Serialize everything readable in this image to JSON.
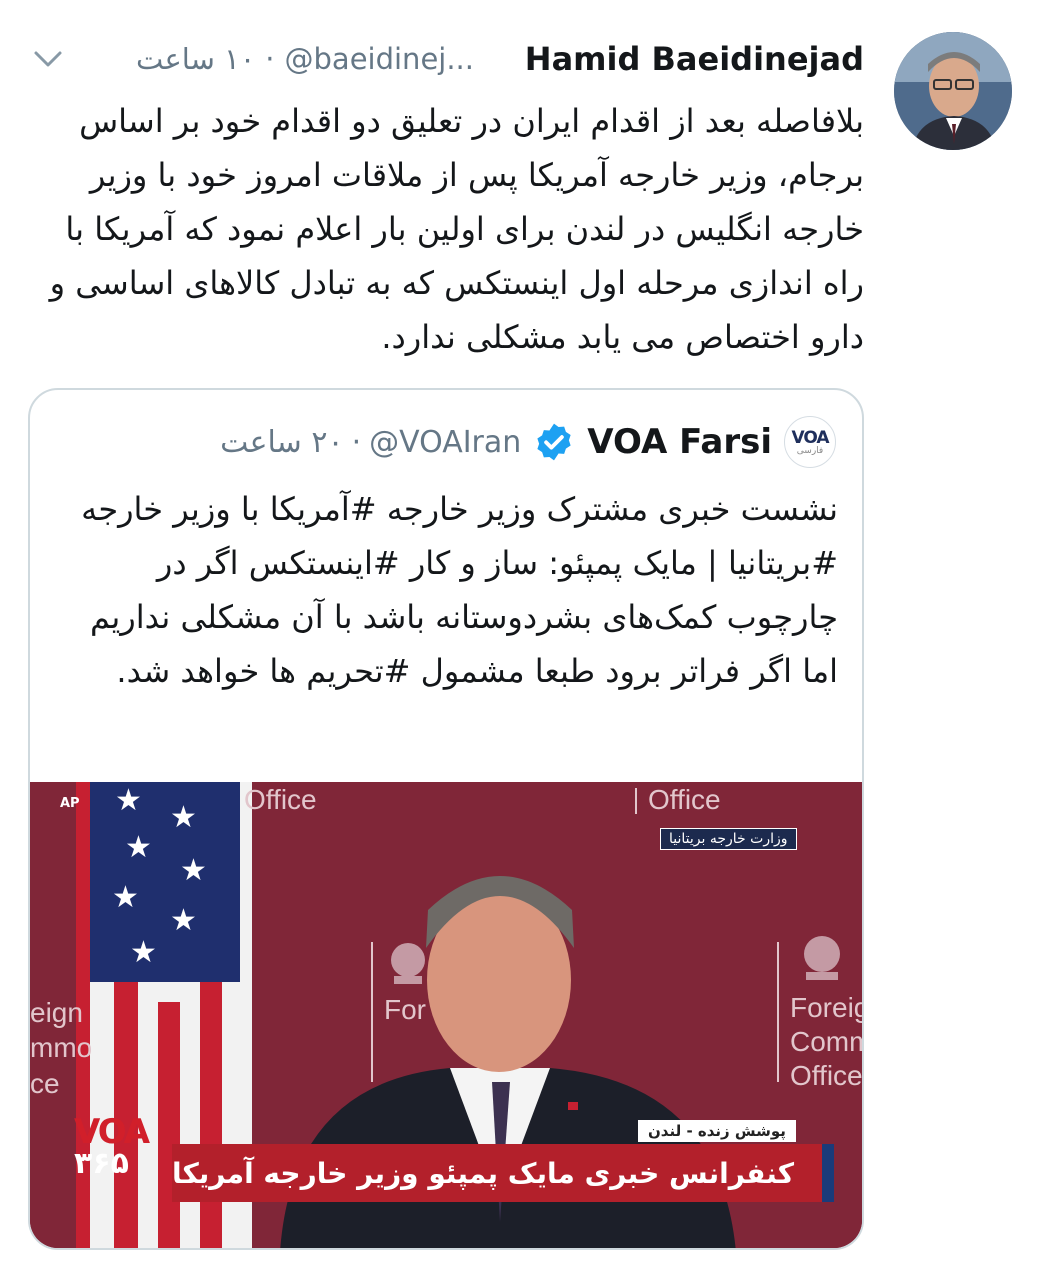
{
  "tweet": {
    "author_name": "Hamid Baeidinejad",
    "handle": "@baeidinej...",
    "separator": "·",
    "time_ago": "۱۰ ساعت",
    "text": "بلافاصله بعد از اقدام ایران در تعلیق دو اقدام خود بر اساس برجام، وزیر خارجه آمریکا پس از ملاقات امروز خود با وزیر خارجه انگلیس در لندن برای اولین بار اعلام نمود که آمریکا با راه اندازی مرحله اول اینستکس که به تبادل کالاهای اساسی و دارو اختصاص می یابد مشکلی ندارد."
  },
  "quoted_tweet": {
    "author_name": "VOA Farsi",
    "verified": true,
    "handle": "@VOAIran",
    "separator": "·",
    "time_ago": "۲۰ ساعت",
    "logo_text": "VOA",
    "logo_subtext": "فارسی",
    "text": "نشست خبری مشترک وزیر خارجه #آمریکا با وزیر خارجه #بریتانیا | مایک پمپئو: ساز و کار #اینستکس اگر در چارچوب کمک‌های بشردوستانه باشد با آن مشکلی نداریم اما اگر فراتر برود طبعا مشمول #تحریم ها خواهد شد.",
    "media": {
      "agency_tag": "AP",
      "backdrop_word_left": "Office",
      "backdrop_word_right": "Office",
      "backdrop_left_fragment": "eign\nmmo\nce",
      "backdrop_left_fragment_lines": [
        "eign",
        "mmo",
        "ce"
      ],
      "backdrop_right_lines": [
        "Foreig",
        "Comm",
        "Office"
      ],
      "podium_text_fragment": "For",
      "ministry_tag": "وزارت خارجه بریتانیا",
      "live_tag": "پوشش زنده - لندن",
      "caption": "کنفرانس خبری مایک پمپئو وزیر خارجه آمریکا",
      "channel_logo_top": "VOA",
      "channel_logo_bottom": "۳۶۵"
    }
  },
  "colors": {
    "text": "#14171a",
    "meta_gray": "#657786",
    "verified_blue": "#1da1f2",
    "card_border": "#cfd9de",
    "backdrop": "#7d2335",
    "lower_third": "#b3202b"
  }
}
